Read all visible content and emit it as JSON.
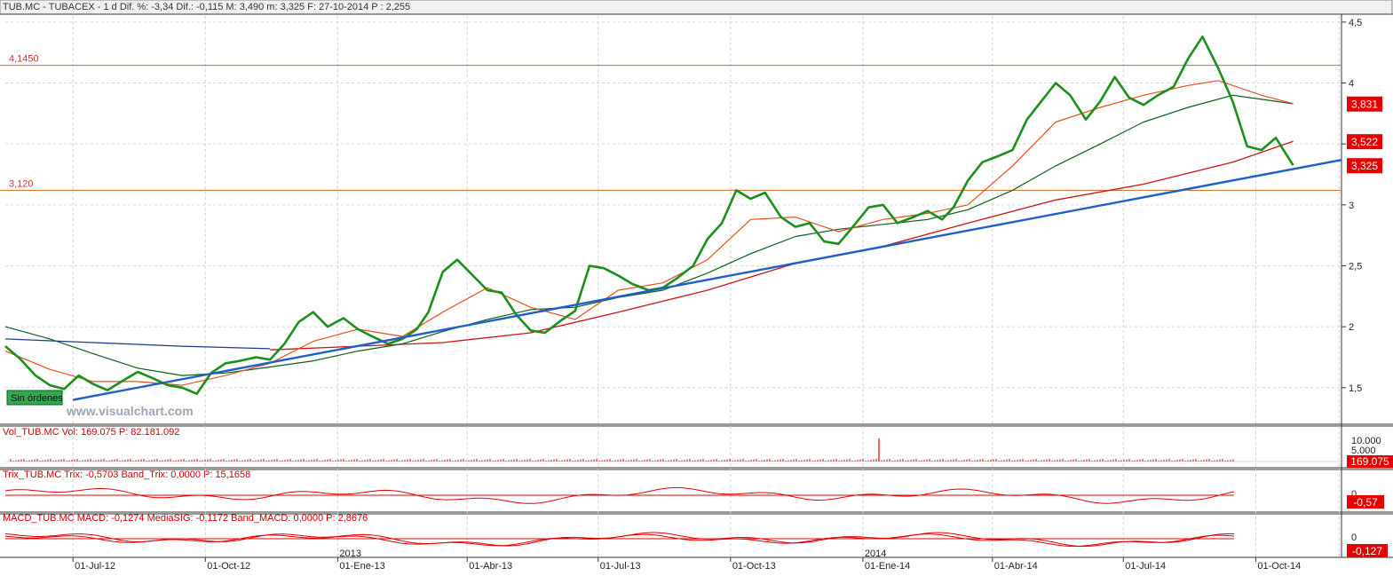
{
  "header": {
    "price": "TUB.MC - TUBACEX -  1 d  Dif. %: -3,34  Dif.: -0,115  M: 3,490  m: 3,325  F: 27-10-2014  P : 2,255",
    "volume": "Vol_TUB.MC  Vol: 169.075  P: 82.181.092",
    "trix": "Trix_TUB.MC  Trix: -0,5703  Band_Trix: 0,0000  P: 15,1658",
    "macd": "MACD_TUB.MC  MACD: -0,1274  MediaSIG: -0,1172  Band_MACD: 0,0000  P: 2,8676"
  },
  "badge": "Sin órdenes",
  "watermark": "www.visualchart.com",
  "colors": {
    "candle": "#1a8f1a",
    "ma_short": "#e8501c",
    "ma_mid": "#0b5d1e",
    "ma_long": "#cc1414",
    "ma_early": "#1f3a8a",
    "trendline": "#1f5fc8",
    "level": "#d2691e",
    "indicator": "#e60000",
    "label_box": "#e60000"
  },
  "chart_data": [
    {
      "type": "line",
      "title": "TUB.MC - TUBACEX",
      "ylim": [
        1.2,
        4.55
      ],
      "y_ticks": [
        "4,5",
        "4",
        "3,5",
        "3",
        "2,5",
        "2",
        "1,5"
      ],
      "x_labels": [
        "01-Jul-12",
        "01-Oct-12",
        "01-Ene-13",
        "01-Abr-13",
        "01-Jul-13",
        "01-Oct-13",
        "01-Ene-14",
        "01-Abr-14",
        "01-Jul-14",
        "01-Oct-14"
      ],
      "year_labels": [
        "2013",
        "2014"
      ],
      "levels": [
        {
          "label": "4,1450",
          "value": 4.145
        },
        {
          "label": "3,120",
          "value": 3.12
        }
      ],
      "trendline": {
        "from": [
          "2012-07-01",
          1.4
        ],
        "to": [
          "2014-11-30",
          3.37
        ]
      },
      "price_boxes": [
        "3,831",
        "3,522",
        "3,325"
      ],
      "series": [
        {
          "role": "close",
          "points": [
            [
              "2012-05-15",
              1.84
            ],
            [
              "2012-05-25",
              1.74
            ],
            [
              "2012-06-05",
              1.6
            ],
            [
              "2012-06-15",
              1.52
            ],
            [
              "2012-06-25",
              1.49
            ],
            [
              "2012-07-05",
              1.6
            ],
            [
              "2012-07-15",
              1.53
            ],
            [
              "2012-07-25",
              1.48
            ],
            [
              "2012-08-05",
              1.56
            ],
            [
              "2012-08-15",
              1.63
            ],
            [
              "2012-08-25",
              1.58
            ],
            [
              "2012-09-05",
              1.52
            ],
            [
              "2012-09-15",
              1.5
            ],
            [
              "2012-09-25",
              1.45
            ],
            [
              "2012-10-05",
              1.62
            ],
            [
              "2012-10-15",
              1.7
            ],
            [
              "2012-10-25",
              1.72
            ],
            [
              "2012-11-05",
              1.75
            ],
            [
              "2012-11-15",
              1.73
            ],
            [
              "2012-11-25",
              1.86
            ],
            [
              "2012-12-05",
              2.04
            ],
            [
              "2012-12-15",
              2.12
            ],
            [
              "2012-12-25",
              2.0
            ],
            [
              "2013-01-05",
              2.07
            ],
            [
              "2013-01-15",
              1.98
            ],
            [
              "2013-01-25",
              1.92
            ],
            [
              "2013-02-05",
              1.86
            ],
            [
              "2013-02-15",
              1.9
            ],
            [
              "2013-02-25",
              1.98
            ],
            [
              "2013-03-05",
              2.12
            ],
            [
              "2013-03-15",
              2.45
            ],
            [
              "2013-03-25",
              2.55
            ],
            [
              "2013-04-05",
              2.42
            ],
            [
              "2013-04-15",
              2.3
            ],
            [
              "2013-04-25",
              2.28
            ],
            [
              "2013-05-05",
              2.1
            ],
            [
              "2013-05-15",
              1.97
            ],
            [
              "2013-05-25",
              1.95
            ],
            [
              "2013-06-05",
              2.05
            ],
            [
              "2013-06-15",
              2.13
            ],
            [
              "2013-06-25",
              2.5
            ],
            [
              "2013-07-05",
              2.48
            ],
            [
              "2013-07-15",
              2.42
            ],
            [
              "2013-07-25",
              2.35
            ],
            [
              "2013-08-05",
              2.3
            ],
            [
              "2013-08-15",
              2.32
            ],
            [
              "2013-08-25",
              2.4
            ],
            [
              "2013-09-05",
              2.5
            ],
            [
              "2013-09-15",
              2.72
            ],
            [
              "2013-09-25",
              2.85
            ],
            [
              "2013-10-05",
              3.12
            ],
            [
              "2013-10-15",
              3.05
            ],
            [
              "2013-10-25",
              3.1
            ],
            [
              "2013-11-05",
              2.9
            ],
            [
              "2013-11-15",
              2.82
            ],
            [
              "2013-11-25",
              2.85
            ],
            [
              "2013-12-05",
              2.7
            ],
            [
              "2013-12-15",
              2.68
            ],
            [
              "2013-12-25",
              2.82
            ],
            [
              "2014-01-05",
              2.98
            ],
            [
              "2014-01-15",
              3.0
            ],
            [
              "2014-01-25",
              2.85
            ],
            [
              "2014-02-05",
              2.9
            ],
            [
              "2014-02-15",
              2.95
            ],
            [
              "2014-02-25",
              2.88
            ],
            [
              "2014-03-05",
              2.98
            ],
            [
              "2014-03-15",
              3.2
            ],
            [
              "2014-03-25",
              3.35
            ],
            [
              "2014-04-05",
              3.4
            ],
            [
              "2014-04-15",
              3.45
            ],
            [
              "2014-04-25",
              3.7
            ],
            [
              "2014-05-05",
              3.85
            ],
            [
              "2014-05-15",
              4.0
            ],
            [
              "2014-05-25",
              3.9
            ],
            [
              "2014-06-05",
              3.7
            ],
            [
              "2014-06-15",
              3.85
            ],
            [
              "2014-06-25",
              4.05
            ],
            [
              "2014-07-05",
              3.88
            ],
            [
              "2014-07-15",
              3.82
            ],
            [
              "2014-07-25",
              3.9
            ],
            [
              "2014-08-05",
              3.97
            ],
            [
              "2014-08-15",
              4.2
            ],
            [
              "2014-08-25",
              4.38
            ],
            [
              "2014-09-05",
              4.12
            ],
            [
              "2014-09-15",
              3.85
            ],
            [
              "2014-09-25",
              3.48
            ],
            [
              "2014-10-05",
              3.45
            ],
            [
              "2014-10-15",
              3.55
            ],
            [
              "2014-10-27",
              3.325
            ]
          ]
        },
        {
          "role": "ma_short",
          "points": [
            [
              "2012-05-15",
              1.8
            ],
            [
              "2012-06-15",
              1.65
            ],
            [
              "2012-07-15",
              1.55
            ],
            [
              "2012-08-15",
              1.55
            ],
            [
              "2012-09-15",
              1.52
            ],
            [
              "2012-10-15",
              1.6
            ],
            [
              "2012-11-15",
              1.7
            ],
            [
              "2012-12-15",
              1.88
            ],
            [
              "2013-01-15",
              1.98
            ],
            [
              "2013-02-15",
              1.92
            ],
            [
              "2013-03-15",
              2.12
            ],
            [
              "2013-04-15",
              2.32
            ],
            [
              "2013-05-15",
              2.16
            ],
            [
              "2013-06-15",
              2.06
            ],
            [
              "2013-07-15",
              2.3
            ],
            [
              "2013-08-15",
              2.36
            ],
            [
              "2013-09-15",
              2.55
            ],
            [
              "2013-10-15",
              2.88
            ],
            [
              "2013-11-15",
              2.9
            ],
            [
              "2013-12-15",
              2.78
            ],
            [
              "2014-01-15",
              2.88
            ],
            [
              "2014-02-15",
              2.93
            ],
            [
              "2014-03-15",
              3.0
            ],
            [
              "2014-04-15",
              3.32
            ],
            [
              "2014-05-15",
              3.68
            ],
            [
              "2014-06-15",
              3.8
            ],
            [
              "2014-07-15",
              3.9
            ],
            [
              "2014-08-15",
              3.98
            ],
            [
              "2014-09-05",
              4.02
            ],
            [
              "2014-10-05",
              3.9
            ],
            [
              "2014-10-27",
              3.831
            ]
          ]
        },
        {
          "role": "ma_mid",
          "points": [
            [
              "2012-05-15",
              2.0
            ],
            [
              "2012-06-15",
              1.9
            ],
            [
              "2012-07-15",
              1.78
            ],
            [
              "2012-08-15",
              1.66
            ],
            [
              "2012-09-15",
              1.6
            ],
            [
              "2012-10-15",
              1.62
            ],
            [
              "2012-11-15",
              1.67
            ],
            [
              "2012-12-15",
              1.72
            ],
            [
              "2013-01-15",
              1.8
            ],
            [
              "2013-02-15",
              1.86
            ],
            [
              "2013-03-15",
              1.96
            ],
            [
              "2013-04-15",
              2.06
            ],
            [
              "2013-05-15",
              2.14
            ],
            [
              "2013-06-15",
              2.16
            ],
            [
              "2013-07-15",
              2.24
            ],
            [
              "2013-08-15",
              2.3
            ],
            [
              "2013-09-15",
              2.44
            ],
            [
              "2013-10-15",
              2.6
            ],
            [
              "2013-11-15",
              2.74
            ],
            [
              "2013-12-15",
              2.8
            ],
            [
              "2014-01-15",
              2.84
            ],
            [
              "2014-02-15",
              2.88
            ],
            [
              "2014-03-15",
              2.96
            ],
            [
              "2014-04-15",
              3.12
            ],
            [
              "2014-05-15",
              3.32
            ],
            [
              "2014-06-15",
              3.5
            ],
            [
              "2014-07-15",
              3.68
            ],
            [
              "2014-08-15",
              3.8
            ],
            [
              "2014-09-15",
              3.9
            ],
            [
              "2014-10-27",
              3.83
            ]
          ]
        },
        {
          "role": "ma_long",
          "points": [
            [
              "2012-11-15",
              1.81
            ],
            [
              "2013-01-15",
              1.84
            ],
            [
              "2013-03-15",
              1.87
            ],
            [
              "2013-05-15",
              1.95
            ],
            [
              "2013-07-15",
              2.12
            ],
            [
              "2013-09-15",
              2.3
            ],
            [
              "2013-11-15",
              2.52
            ],
            [
              "2014-01-15",
              2.66
            ],
            [
              "2014-03-15",
              2.85
            ],
            [
              "2014-05-15",
              3.04
            ],
            [
              "2014-07-15",
              3.17
            ],
            [
              "2014-09-15",
              3.35
            ],
            [
              "2014-10-27",
              3.522
            ]
          ]
        },
        {
          "role": "ma_early",
          "points": [
            [
              "2012-05-15",
              1.9
            ],
            [
              "2012-07-15",
              1.87
            ],
            [
              "2012-09-15",
              1.84
            ],
            [
              "2012-11-15",
              1.82
            ]
          ]
        }
      ]
    },
    {
      "type": "bar",
      "title": "Vol_TUB.MC",
      "y_ticks": [
        "10.000",
        "5.000"
      ],
      "last_value": "169.075"
    },
    {
      "type": "line",
      "title": "Trix_TUB.MC",
      "last_value": "-0,57",
      "y_ticks": [
        "0"
      ]
    },
    {
      "type": "line",
      "title": "MACD_TUB.MC",
      "last_value": "-0,127",
      "y_ticks": [
        "0"
      ]
    }
  ]
}
